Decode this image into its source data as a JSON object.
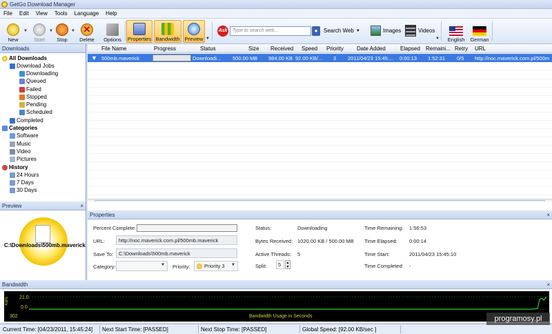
{
  "window": {
    "title": "GetGo Download Manager"
  },
  "menu": [
    "File",
    "Edit",
    "View",
    "Tools",
    "Language",
    "Help"
  ],
  "toolbar": {
    "new": "New",
    "start": "Start",
    "stop": "Stop",
    "delete": "Delete",
    "options": "Options",
    "properties": "Properties",
    "bandwidth": "Bandwidth",
    "preview": "Preview",
    "search_placeholder": "Type to search web...",
    "search_web": "Search Web",
    "images": "Images",
    "videos": "Videos",
    "english": "English",
    "german": "German",
    "ask": "Ask"
  },
  "downloads_panel": {
    "title": "Downloads",
    "all": "All Downloads",
    "jobs": "Download Jobs",
    "downloading": "Downloading",
    "queued": "Queued",
    "failed": "Failed",
    "stopped": "Stopped",
    "pending": "Pending",
    "scheduled": "Scheduled",
    "completed": "Completed",
    "categories": "Categories",
    "software": "Software",
    "music": "Music",
    "video": "Video",
    "pictures": "Pictures",
    "history": "History",
    "h24": "24 Hours",
    "d7": "7 Days",
    "d30": "30 Days"
  },
  "grid": {
    "columns": [
      "File Name",
      "Progress",
      "Status",
      "Size",
      "Received",
      "Speed",
      "Priority",
      "Date Added",
      "Elapsed",
      "Remaini...",
      "Retry",
      "URL"
    ],
    "row": {
      "file": "500mb.maverick",
      "status": "Downloadi...",
      "size": "500.00 MB",
      "received": "984.00 KB",
      "speed": "92.00 KB/...",
      "priority": "3",
      "date": "2011/04/23 15:45:...",
      "elapsed": "0:00:13",
      "remaining": "1:52:31",
      "retry": "0/5",
      "url": "http://noc.maverick.com.pl/500m"
    }
  },
  "preview": {
    "title": "Preview",
    "path": "C:\\Downloads\\500mb.maverick"
  },
  "properties": {
    "title": "Properties",
    "percent_label": "Percent Complete:",
    "url_label": "URL:",
    "url": "http://noc.maverick.com.pl/500mb.maverick",
    "save_label": "Save To:",
    "save": "C:\\Downloads\\500mb.maverick",
    "category_label": "Category:",
    "priority_label": "Priority:",
    "priority": "Priority 3",
    "status_label": "Status:",
    "status": "Downloading",
    "bytes_label": "Bytes Received:",
    "bytes": "1020.00 KB / 500.00 MB",
    "threads_label": "Active Threads:",
    "threads": "5",
    "split_label": "Split:",
    "split": "5",
    "tremain_label": "Time Remaining:",
    "tremain": "1:56:53",
    "telapsed_label": "Time Elapsed:",
    "telapsed": "0:00:14",
    "tstart_label": "Time Start:",
    "tstart": "2011/04/23 15:45:10",
    "tcomp_label": "Time Completed:",
    "tcomp": "-"
  },
  "bandwidth": {
    "title": "Bandwidth",
    "y_top": "21.0",
    "y_bot": "0.0",
    "unit": "KB/s",
    "x_left": "302",
    "caption": "Bandwidth Usage in Seconds"
  },
  "status": {
    "current": "Current Time: [04/23/2011, 15:45:24]",
    "next_start": "Next Start Time: [PASSED]",
    "next_stop": "Next Stop Time: [PASSED]",
    "global": "Global Speed: [92.00 KB/sec ]"
  },
  "watermark": "programosy.pl",
  "close": "×"
}
